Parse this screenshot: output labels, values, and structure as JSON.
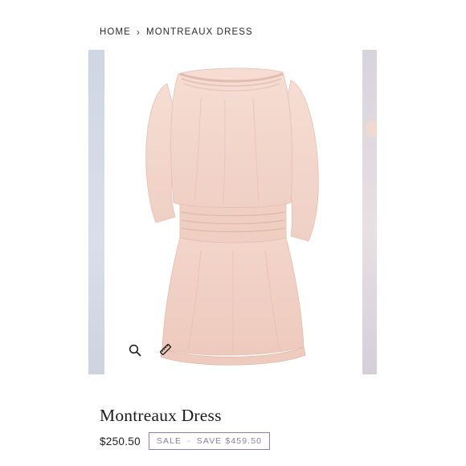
{
  "breadcrumb": {
    "home": "HOME",
    "separator": "›",
    "current": "MONTREAUX DRESS"
  },
  "gallery": {
    "image_subject": "blush pink off-shoulder smocked mini dress",
    "zoom_icon": "magnifier-icon",
    "measure_icon": "ruler-icon"
  },
  "product": {
    "title": "Montreaux Dress",
    "price": "$250.50",
    "sale_label": "SALE",
    "sale_separator": "-",
    "save_text": "SAVE $459.50"
  },
  "colors": {
    "dress": "#f3d6cc",
    "badge_accent": "#8e7fa6"
  }
}
